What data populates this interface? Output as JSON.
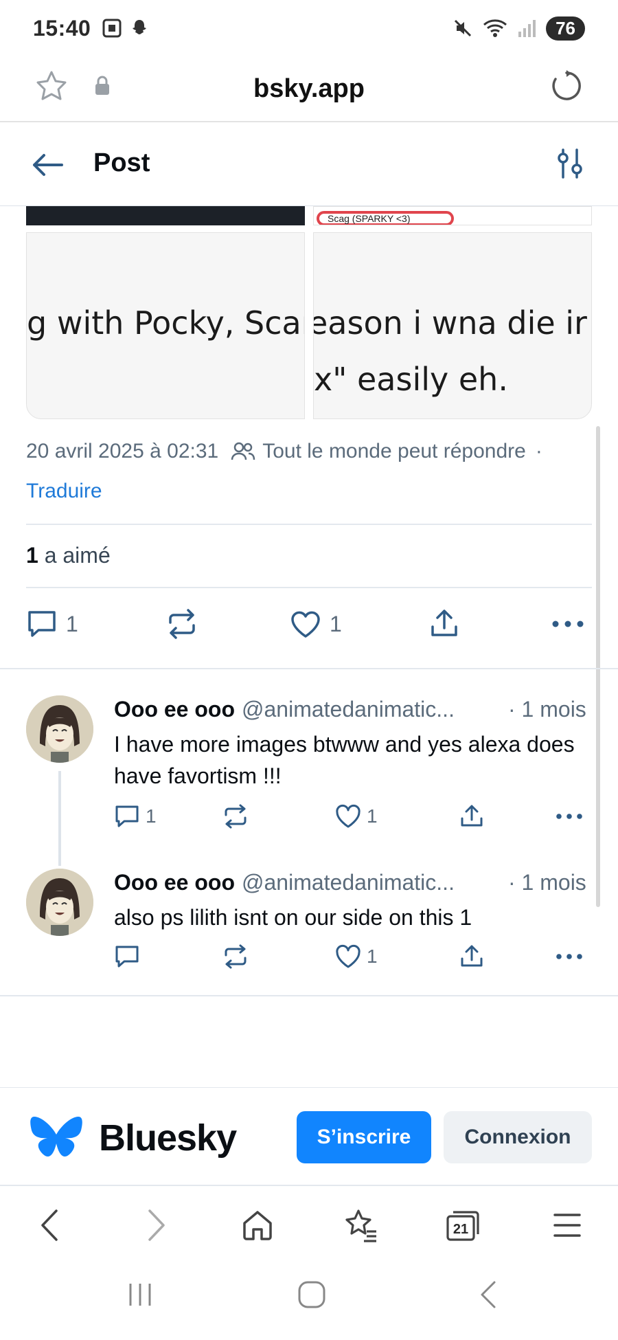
{
  "status_bar": {
    "time": "15:40",
    "battery": "76"
  },
  "browser": {
    "url": "bsky.app",
    "tabs_count": "21"
  },
  "header": {
    "title": "Post"
  },
  "images": {
    "left_text": "g with Pocky, Scarle",
    "right_text_line1": "eason i wna die ir",
    "right_text_line2": "x\" easily eh.",
    "top_right_snippet": "Scag (SPARKY <3)"
  },
  "post": {
    "date": "20 avril 2025 à 02:31",
    "reply_policy": "Tout le monde peut répondre",
    "separator_dot": "·",
    "translate": "Traduire",
    "likes_count": "1",
    "likes_label": "a aimé",
    "replies_count": "1",
    "like_count_bar": "1"
  },
  "replies": [
    {
      "name": "Ooo ee ooo",
      "handle": "@animatedanimatic...",
      "time": "· 1 mois",
      "text": "I have more images btwww and yes alexa does have favortism !!!",
      "reply_count": "1",
      "like_count": "1"
    },
    {
      "name": "Ooo ee ooo",
      "handle": "@animatedanimatic...",
      "time": "· 1 mois",
      "text": "also ps lilith isnt on our side on this 1",
      "reply_count": "",
      "like_count": "1"
    }
  ],
  "banner": {
    "brand": "Bluesky",
    "signup": "S’inscrire",
    "login": "Connexion"
  },
  "colors": {
    "accent": "#1185fe",
    "link": "#1f7ad8",
    "muted": "#5b6b7b"
  }
}
